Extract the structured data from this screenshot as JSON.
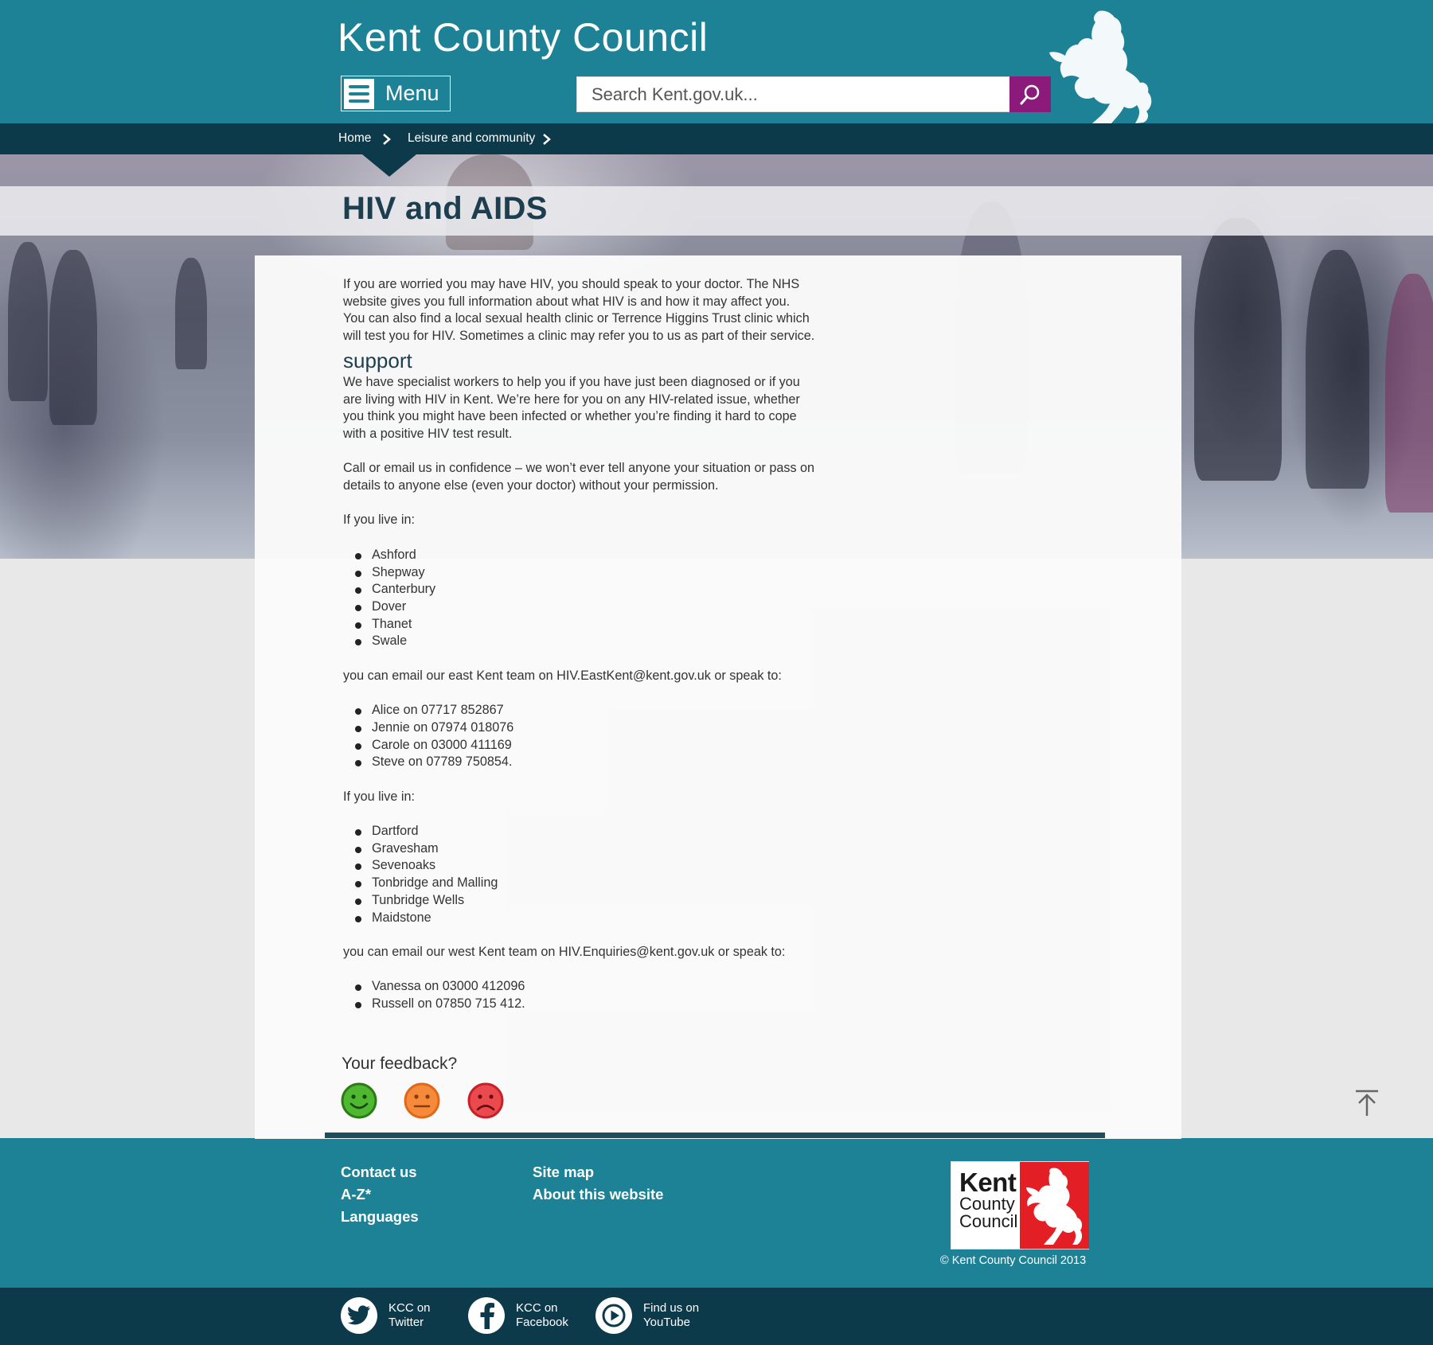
{
  "header": {
    "site_title": "Kent County Council",
    "menu_label": "Menu",
    "search_placeholder": "Search Kent.gov.uk..."
  },
  "breadcrumb": {
    "items": [
      {
        "label": "Home"
      },
      {
        "label": "Leisure and community"
      }
    ]
  },
  "page": {
    "title": "HIV and AIDS",
    "intro": [
      "If you are worried you may have HIV, you should speak to your doctor. The NHS",
      "website gives you full information about what HIV is and how it may affect you.",
      "You can also find a local sexual health clinic or Terrence Higgins Trust clinic which",
      "will test you for HIV.  Sometimes a clinic may refer you to us as part of their service."
    ],
    "support_heading": "support",
    "support_para": [
      "We have specialist workers to help you if you have just been diagnosed or if you",
      "are living with HIV in Kent. We’re here for you on any HIV-related issue, whether",
      "you think you might have been infected or whether you’re finding it hard to cope",
      "with a positive HIV test result."
    ],
    "confidence_para": [
      "Call or email us in confidence – we won’t ever tell anyone your situation or pass on",
      "details to anyone else (even your doctor) without your permission."
    ],
    "live_in_1": "If you live in:",
    "east_areas": [
      "Ashford",
      "Shepway",
      "Canterbury",
      "Dover",
      "Thanet",
      "Swale"
    ],
    "east_email_line": "you can email our east Kent team on HIV.EastKent@kent.gov.uk or speak to:",
    "east_contacts": [
      "Alice on 07717 852867",
      "Jennie on 07974 018076",
      "Carole on 03000 411169",
      "Steve on 07789 750854."
    ],
    "live_in_2": "If you live in:",
    "west_areas": [
      "Dartford",
      "Gravesham",
      "Sevenoaks",
      "Tonbridge and Malling",
      "Tunbridge Wells",
      "Maidstone"
    ],
    "west_email_line": "you can email our west Kent team on HIV.Enquiries@kent.gov.uk or speak to:",
    "west_contacts": [
      "Vanessa on 03000 412096",
      "Russell on 07850 715 412."
    ]
  },
  "feedback": {
    "title": "Your feedback?",
    "faces": [
      "happy-face-icon",
      "neutral-face-icon",
      "sad-face-icon"
    ]
  },
  "footer": {
    "links_col1": [
      "Contact us",
      "A-Z*",
      "Languages"
    ],
    "links_col2": [
      "Site map",
      "About this website"
    ],
    "logo_text": {
      "kent": "Kent",
      "county": "County",
      "council": "Council"
    },
    "copyright": "© Kent County Council 2013",
    "social": [
      {
        "line1": "KCC on",
        "line2": "Twitter",
        "icon": "twitter-icon"
      },
      {
        "line1": "KCC on",
        "line2": "Facebook",
        "icon": "facebook-icon"
      },
      {
        "line1": "Find us on",
        "line2": "YouTube",
        "icon": "youtube-icon"
      }
    ]
  },
  "colors": {
    "header_teal": "#1e8296",
    "dark_navy": "#0d3a4a",
    "search_purple": "#8c1a7a",
    "title_text": "#1d3e4e",
    "logo_red": "#e31e24"
  }
}
